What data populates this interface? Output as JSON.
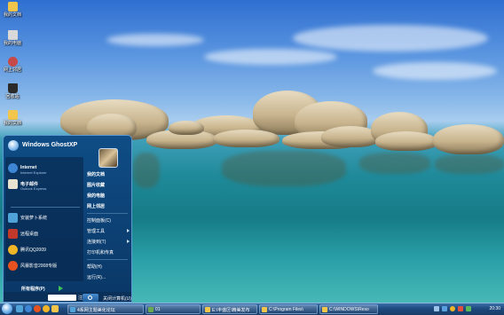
{
  "desktop_icons": [
    {
      "label": "我的文档",
      "name": "desktop-icon-my-documents",
      "icon": "folder-icon",
      "color": "#f1c64a"
    },
    {
      "label": "我的电脑",
      "name": "desktop-icon-my-computer",
      "icon": "computer-icon",
      "color": "#d9d9d9"
    },
    {
      "label": "网上邻居",
      "name": "desktop-icon-network",
      "icon": "network-icon",
      "color": "#c74a4a"
    },
    {
      "label": "回收站",
      "name": "desktop-icon-recycle-bin",
      "icon": "recycle-bin-icon",
      "color": "#2b2b2b"
    },
    {
      "label": "我的文档",
      "name": "desktop-icon-folder",
      "icon": "folder-icon",
      "color": "#f1c64a"
    }
  ],
  "start_menu": {
    "brand": "Windows GhostXP",
    "pinned": [
      {
        "label": "Internet",
        "sub": "Internet Explorer",
        "icon": "ie-icon",
        "color": "#3d86d6"
      },
      {
        "label": "电子邮件",
        "sub": "Outlook Express",
        "icon": "email-icon",
        "color": "#e8e2d0"
      }
    ],
    "recent": [
      {
        "label": "安装萝卜系统",
        "icon": "install-icon",
        "color": "#4fa3d8"
      },
      {
        "label": "远程桌面",
        "icon": "remote-desktop-icon",
        "color": "#c0392b"
      },
      {
        "label": "腾讯QQ2009",
        "icon": "qq-icon",
        "color": "#f0b429"
      },
      {
        "label": "风暴影音2008专版",
        "icon": "media-player-icon",
        "color": "#e6521f"
      }
    ],
    "all_programs": "所有程序(P)",
    "right_items": [
      {
        "label": "我的文档",
        "bold": true,
        "arrow": false
      },
      {
        "label": "图片收藏",
        "bold": true,
        "arrow": false
      },
      {
        "label": "我的电脑",
        "bold": true,
        "arrow": false
      },
      {
        "label": "网上邻居",
        "bold": true,
        "arrow": false
      },
      {
        "label": "控制面板(C)",
        "bold": false,
        "arrow": false
      },
      {
        "label": "管理工具",
        "bold": false,
        "arrow": true
      },
      {
        "label": "连接到(T)",
        "bold": false,
        "arrow": true
      },
      {
        "label": "打印机和传真",
        "bold": false,
        "arrow": false
      },
      {
        "label": "帮助(H)",
        "bold": false,
        "arrow": false
      },
      {
        "label": "运行(R)...",
        "bold": false,
        "arrow": false
      }
    ],
    "lock_label": "注销(L)",
    "shutdown_label": "关闭计算机(U)"
  },
  "taskbar": {
    "buttons": [
      {
        "label": "4系网主题美化论坛",
        "color": "#4fa3d8"
      },
      {
        "label": "01",
        "color": "#6aa84f"
      },
      {
        "label": "E:\\丰盛区\\精美发布",
        "color": "#f1c64a"
      },
      {
        "label": "C:\\Program Files\\",
        "color": "#f1c64a"
      },
      {
        "label": "C:\\WINDOWS\\Reso",
        "color": "#f1c64a"
      }
    ],
    "tray_icons": [
      "volume-icon",
      "network-icon",
      "qq-tray-icon",
      "shield-icon",
      "im-icon"
    ],
    "clock": "20:30"
  }
}
